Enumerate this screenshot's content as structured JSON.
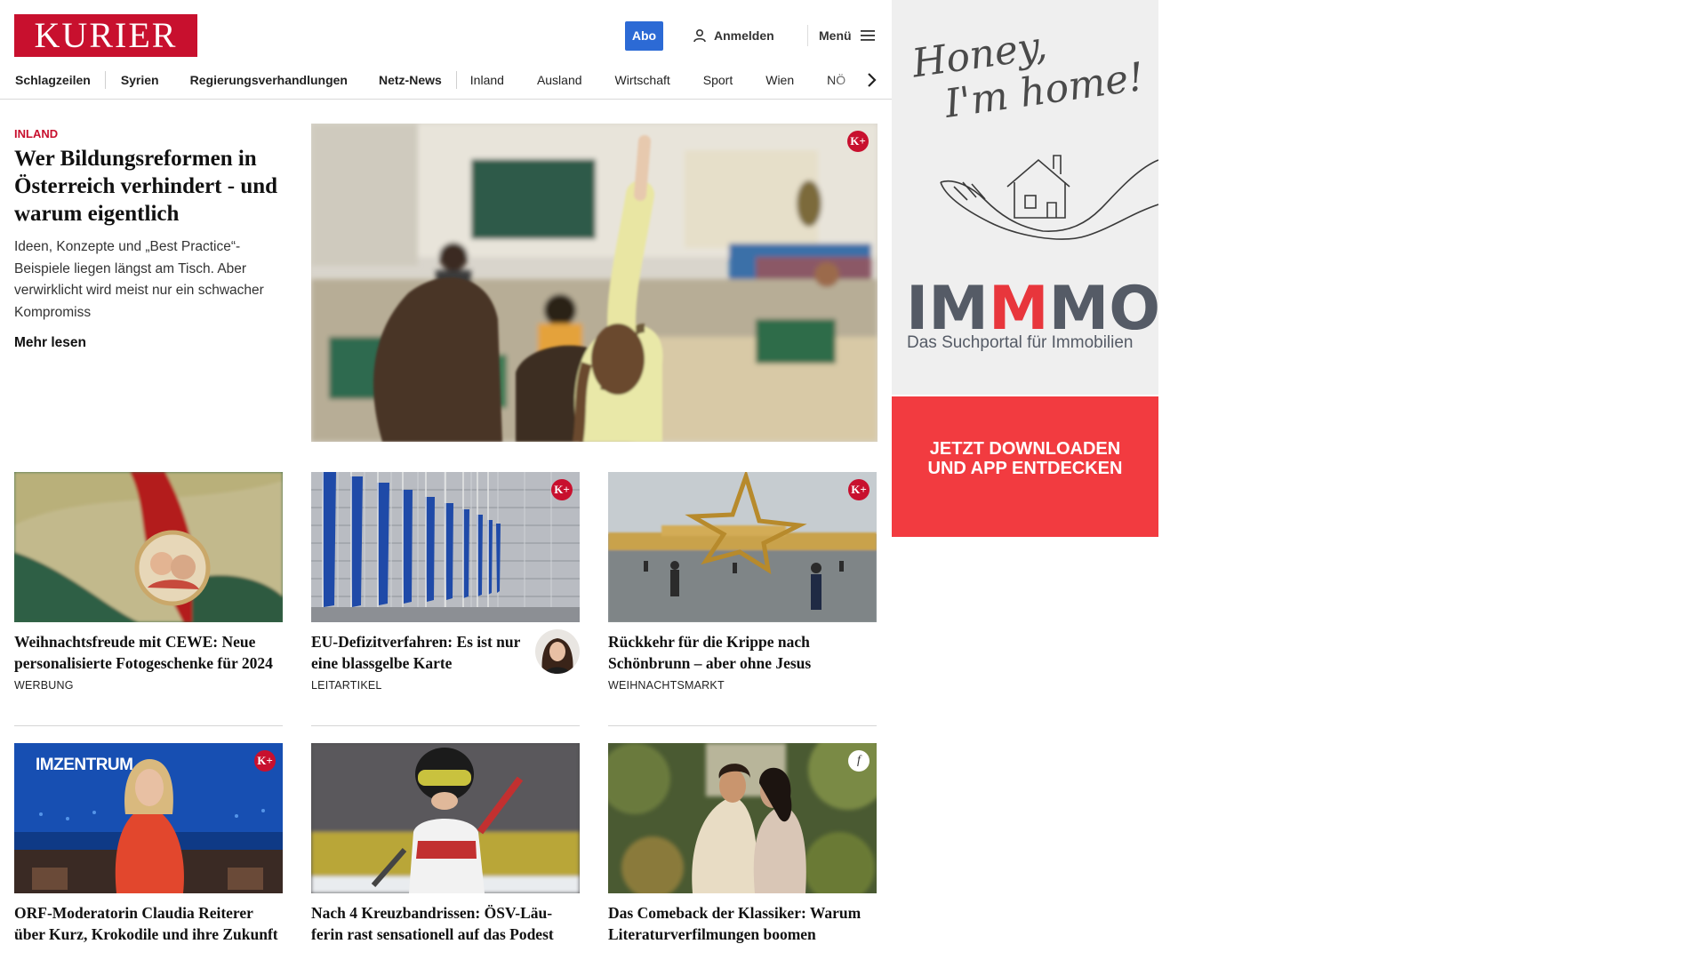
{
  "header": {
    "logo": "KURIER",
    "abo_label": "Abo",
    "login_label": "Anmelden",
    "menu_label": "Menü"
  },
  "nav": {
    "items": [
      {
        "label": "Schlagzeilen",
        "bold": true
      },
      {
        "label": "Syrien",
        "bold": true
      },
      {
        "label": "Regierungsverhandlungen",
        "bold": true
      },
      {
        "label": "Netz-News",
        "bold": true
      },
      {
        "label": "Inland",
        "bold": false
      },
      {
        "label": "Ausland",
        "bold": false
      },
      {
        "label": "Wirtschaft",
        "bold": false
      },
      {
        "label": "Sport",
        "bold": false
      },
      {
        "label": "Wien",
        "bold": false
      },
      {
        "label": "NÖ",
        "bold": false
      }
    ],
    "next_icon": "chevron-right-icon"
  },
  "hero": {
    "kicker": "INLAND",
    "title": "Wer Bildungsreformen in Österreich verhindert - und warum eigentlich",
    "teaser": "Ideen, Konzepte und „Best Practice“-Beispiele liegen längst am Tisch. Aber verwirklicht wird meist nur ein schwacher Kompromiss",
    "more_label": "Mehr lesen",
    "badge": "K+"
  },
  "cards": [
    {
      "title": "Weihnachtsfreude mit CEWE: Neue personalisierte Fotogeschenke für 2024",
      "label": "WERBUNG",
      "badge": ""
    },
    {
      "title": "EU-Defizitverfahren: Es ist nur eine blassgelbe Karte",
      "label": "LEITARTIKEL",
      "badge": "K+"
    },
    {
      "title": "Rückkehr für die Krippe nach Schönbrunn – aber ohne Jesus",
      "label": "WEIHNACHTSMARKT",
      "badge": "K+"
    },
    {
      "title": "ORF-Moderatorin Claudia Reiterer über Kurz, Krokodile und ihre Zukunft",
      "label": "",
      "badge": "K+",
      "img_text": "IMZENTRUM"
    },
    {
      "title": "Nach 4 Kreuzbandrissen: ÖSV-Läu-ferin rast sensationell auf das Podest",
      "label": "",
      "badge": ""
    },
    {
      "title": "Das Comeback der Klassiker: Warum Literaturverfilmungen boomen",
      "label": "",
      "badge": "f"
    }
  ],
  "ad": {
    "script_line1": "Honey,",
    "script_line2": "I'm home!",
    "brand_a": "IM",
    "brand_b": "M",
    "brand_c": "MO",
    "subtitle": "Das Suchportal für Immobilien",
    "cta_line1": "JETZT DOWNLOADEN",
    "cta_line2": "UND APP ENTDECKEN"
  },
  "colors": {
    "brand_red": "#c8102e",
    "abo_blue": "#2c6ad5",
    "ad_red": "#f23b40"
  }
}
